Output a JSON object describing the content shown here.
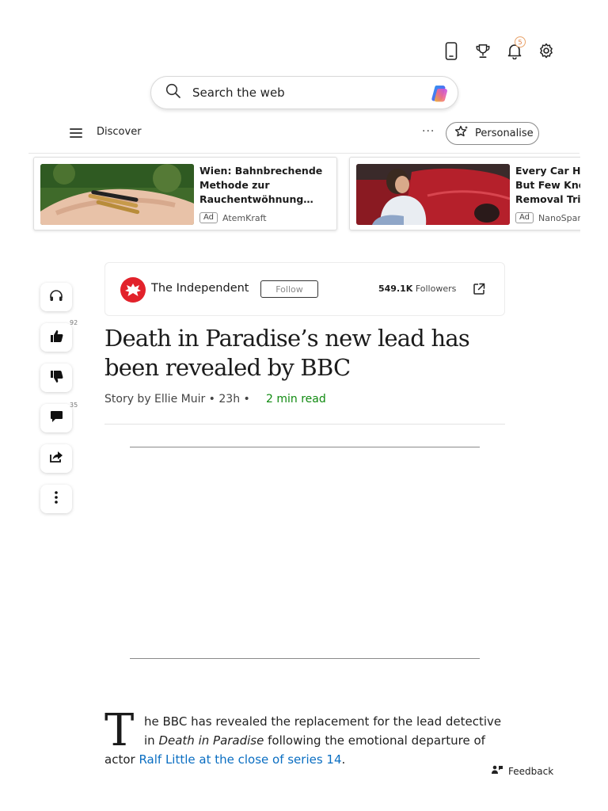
{
  "header": {
    "icons": [
      "phone-icon",
      "trophy-icon",
      "bell-icon",
      "settings-gear-icon"
    ],
    "notification_count": "5"
  },
  "search": {
    "placeholder": "Search the web"
  },
  "nav": {
    "discover_label": "Discover",
    "more_label": "···",
    "personalise_label": "Personalise"
  },
  "ads": [
    {
      "title": "Wien: Bahnbrechende\nMethode zur\nRauchentwöhnung…",
      "tag": "Ad",
      "source": "AtemKraft"
    },
    {
      "title": "Every Car Has\nBut Few Know\nRemoval Trick",
      "tag": "Ad",
      "source": "NanoSpark"
    }
  ],
  "rail": {
    "like_count": "92",
    "comment_count": "35"
  },
  "publisher": {
    "name": "The Independent",
    "follow_label": "Follow",
    "followers_count": "549.1K",
    "followers_label": "Followers"
  },
  "article": {
    "headline": "Death in Paradise’s new lead has been revealed by BBC",
    "byline": "Story by Ellie Muir • 23h •",
    "read_time": "2 min read",
    "dropcap": "T",
    "line1": "he BBC has revealed the replacement for the lead detective",
    "line2_prefix": "in ",
    "line2_italic": "Death in Paradise",
    "line2_suffix": " following the emotional departure of",
    "line3_prefix": "actor ",
    "line3_link": "Ralf Little at the close of series 14",
    "line3_suffix": "."
  },
  "feedback": {
    "label": "Feedback"
  },
  "colors": {
    "link": "#0a6ec2",
    "read_time": "#108a10",
    "publisher_brand": "#e2222b"
  }
}
